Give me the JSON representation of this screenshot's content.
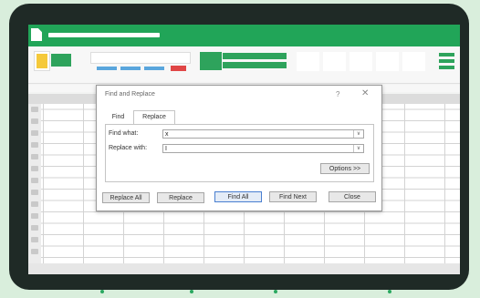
{
  "dialog": {
    "title": "Find and Replace",
    "help_icon": "?",
    "close_icon": "✕",
    "tabs": [
      {
        "label": "Find",
        "active": false
      },
      {
        "label": "Replace",
        "active": true
      }
    ],
    "find_what_label": "Find what:",
    "find_what_value": "x",
    "replace_with_label": "Replace with:",
    "replace_with_value": "I",
    "dropdown_icon": "∨",
    "options_label": "Options >>",
    "buttons": {
      "replace_all": "Replace All",
      "replace": "Replace",
      "find_all": "Find All",
      "find_next": "Find Next",
      "close": "Close"
    }
  },
  "colors": {
    "accent_green": "#21a558",
    "device_frame": "#1f2a26",
    "background": "#d9eedc",
    "ribbon_blue": "#5aa6dd",
    "ribbon_red": "#e04646",
    "ribbon_yellow": "#f5c93a"
  },
  "icons": {
    "app": "spreadsheet-app-icon"
  }
}
